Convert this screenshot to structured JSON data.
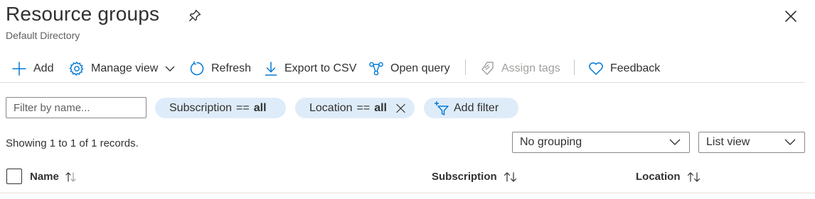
{
  "header": {
    "title": "Resource groups",
    "subtitle": "Default Directory"
  },
  "toolbar": {
    "add_label": "Add",
    "manage_view_label": "Manage view",
    "refresh_label": "Refresh",
    "export_label": "Export to CSV",
    "open_query_label": "Open query",
    "assign_tags_label": "Assign tags",
    "feedback_label": "Feedback"
  },
  "filters": {
    "search_placeholder": "Filter by name...",
    "subscription": {
      "field": "Subscription",
      "operator": "==",
      "value": "all"
    },
    "location": {
      "field": "Location",
      "operator": "==",
      "value": "all"
    },
    "add_filter_label": "Add filter"
  },
  "records": {
    "summary": "Showing 1 to 1 of 1 records.",
    "grouping_selected": "No grouping",
    "view_selected": "List view"
  },
  "table": {
    "columns": [
      {
        "label": "Name"
      },
      {
        "label": "Subscription"
      },
      {
        "label": "Location"
      }
    ]
  },
  "colors": {
    "accent": "#0078d4",
    "pill_bg": "#deecf9",
    "disabled": "#a19f9d"
  }
}
